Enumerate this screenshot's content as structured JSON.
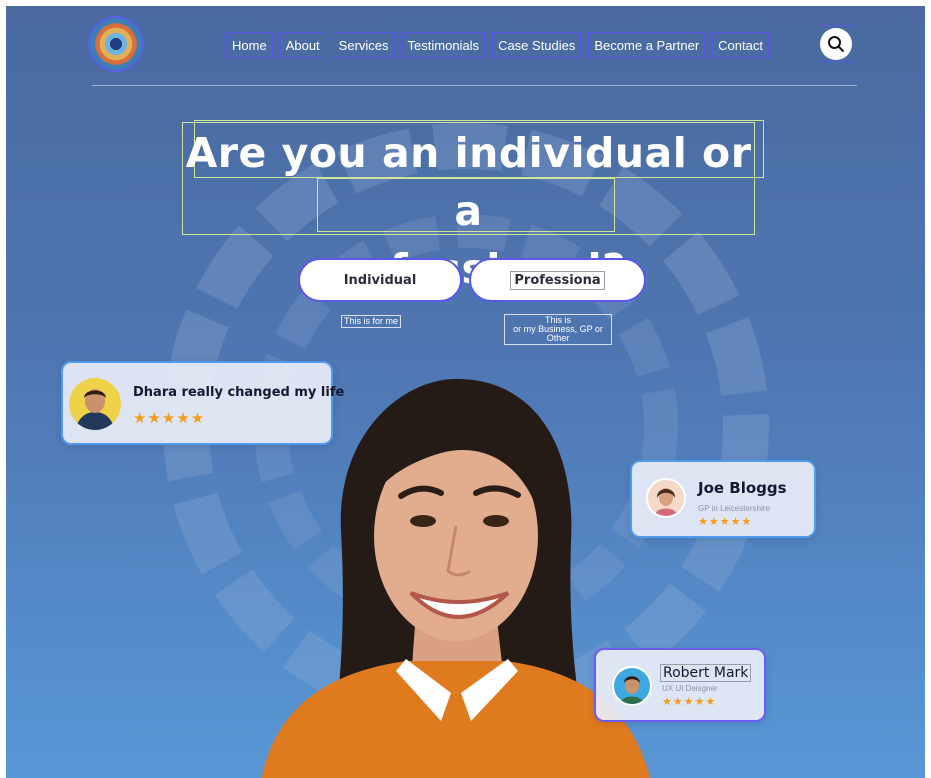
{
  "header": {
    "nav": [
      "Home",
      "About",
      "Services",
      "Testimonials",
      "Case Studies",
      "Become a Partner",
      "Contact"
    ]
  },
  "hero": {
    "headline_line1": "Are you an individual or a",
    "headline_line2": "professional?",
    "individual_button": "Individual",
    "individual_caption": "This is for me",
    "professional_button": "Professiona",
    "professional_caption_line1": "This is",
    "professional_caption_line2": "or my Business, GP or Other"
  },
  "reviews": [
    {
      "name": "Dhara really changed my life",
      "stars": "★★★★★",
      "rating": 5
    },
    {
      "name": "Joe Bloggs",
      "subtitle": "GP in Leicestershire",
      "stars": "★★★★★",
      "rating": 5
    },
    {
      "name": "Robert Mark",
      "subtitle": "UX UI Deisgner",
      "stars": "★★★★★",
      "rating": 5
    }
  ],
  "colors": {
    "accent_outline": "#5a57e8",
    "headline_outline": "#cfe59a",
    "star": "#f59a1b",
    "sweater": "#e07a1f"
  },
  "icons": [
    "logo-icon",
    "search-icon",
    "star-icon"
  ]
}
